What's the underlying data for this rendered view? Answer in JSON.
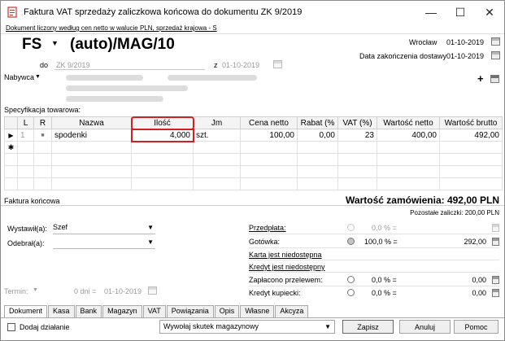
{
  "window": {
    "title": "Faktura VAT sprzedaży zaliczkowa końcowa do dokumentu ZK 9/2019",
    "minimize": "—",
    "maximize": "☐",
    "close": "✕"
  },
  "header": {
    "link": "Dokument liczony według cen netto w walucie PLN, sprzedaż krajowa - S",
    "doc_prefix": "FS",
    "doc_number": "(auto)/MAG/10",
    "do_label": "do",
    "do_value": "ZK 9/2019",
    "z_label": "z",
    "z_value": "01-10-2019",
    "place": "Wrocław",
    "place_date": "01-10-2019",
    "delivery_label": "Data zakończenia dostawy",
    "delivery_date": "01-10-2019",
    "buyer_label": "Nabywca",
    "add_icon": "+"
  },
  "spec": {
    "label": "Specyfikacja towarowa:",
    "columns": [
      "",
      "L",
      "R",
      "Nazwa",
      "Ilość",
      "Jm",
      "Cena netto",
      "Rabat (%",
      "VAT (%)",
      "Wartość netto",
      "Wartość brutto"
    ],
    "rows": [
      {
        "marker": "▶",
        "lp": "1",
        "r": "■",
        "name": "spodenki",
        "qty": "4,000",
        "unit": "szt.",
        "price": "100,00",
        "discount": "0,00",
        "vat": "23",
        "net": "400,00",
        "gross": "492,00"
      }
    ],
    "new_row_marker": "✱"
  },
  "summary": {
    "section_title": "Faktura końcowa",
    "total_label": "Wartość zamówienia: 492,00 PLN",
    "remaining_label": "Pozostałe zaliczki: 200,00 PLN"
  },
  "people": {
    "issued_label": "Wystawił(a):",
    "issued_value": "Szef",
    "received_label": "Odebrał(a):",
    "received_value": ""
  },
  "term": {
    "label": "Termin:",
    "days": "0 dni =",
    "date": "01-10-2019"
  },
  "payments": [
    {
      "label": "Przedpłata:",
      "percent": "0,0 % =",
      "amount": "",
      "link": true
    },
    {
      "label": "Gotówka:",
      "percent": "100,0 % =",
      "amount": "292,00",
      "link": false
    },
    {
      "label": "Karta jest niedostępna",
      "percent": "",
      "amount": "",
      "link": true
    },
    {
      "label": "Kredyt jest niedostępny",
      "percent": "",
      "amount": "",
      "link": true
    },
    {
      "label": "Zapłacono przelewem:",
      "percent": "0,0 % =",
      "amount": "0,00",
      "link": false
    },
    {
      "label": "Kredyt kupiecki:",
      "percent": "0,0 % =",
      "amount": "0,00",
      "link": false
    }
  ],
  "tabs": [
    "Dokument",
    "Kasa",
    "Bank",
    "Magazyn",
    "VAT",
    "Powiązania",
    "Opis",
    "Własne",
    "Akcyza"
  ],
  "footer": {
    "checkbox_label": "Dodaj działanie",
    "select_value": "Wywołaj skutek magazynowy",
    "save": "Zapisz",
    "cancel": "Anuluj",
    "help": "Pomoc"
  },
  "colors": {
    "highlight": "#d21f1f",
    "primary_button_border": "#2a73cf"
  }
}
